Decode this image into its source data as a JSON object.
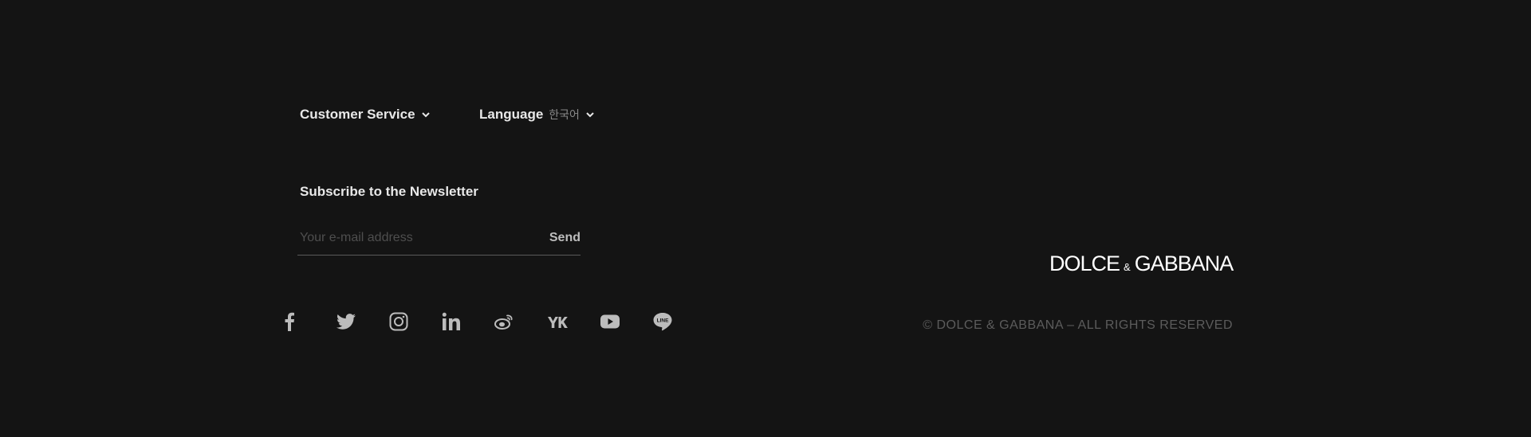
{
  "footer": {
    "customer_service": {
      "label": "Customer Service"
    },
    "language": {
      "label": "Language",
      "value": "한국어"
    },
    "newsletter": {
      "title": "Subscribe to the Newsletter",
      "email_placeholder": "Your e-mail address",
      "email_value": "",
      "send_label": "Send"
    },
    "social_icons": [
      "facebook-icon",
      "twitter-icon",
      "instagram-icon",
      "linkedin-icon",
      "weibo-icon",
      "youku-icon",
      "youtube-icon",
      "line-icon"
    ],
    "brand": {
      "left": "DOLCE",
      "amp": "&",
      "right": "GABBANA"
    },
    "copyright": "© DOLCE & GABBANA – ALL RIGHTS RESERVED"
  },
  "colors": {
    "background": "#141414",
    "text": "#e8e8e8",
    "muted": "#5c5c5c",
    "icon": "#bcbcbc"
  }
}
